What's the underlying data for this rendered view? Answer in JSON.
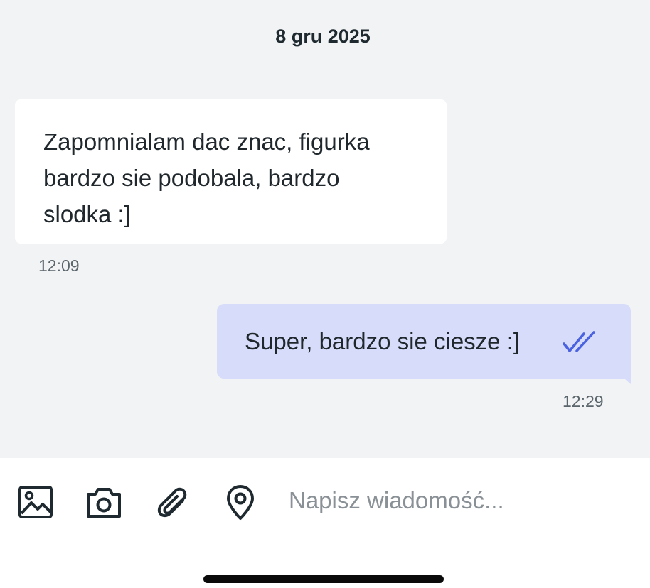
{
  "date_separator": "8 gru 2025",
  "messages": [
    {
      "direction": "incoming",
      "lines": [
        "Zapomnialam dac znac, figurka",
        "bardzo sie podobala, bardzo",
        "slodka :]"
      ],
      "time": "12:09"
    },
    {
      "direction": "outgoing",
      "text": "Super, bardzo sie ciesze :]",
      "time": "12:29",
      "status_icon": "double-check-icon"
    }
  ],
  "composer": {
    "placeholder": "Napisz wiadomość...",
    "icons": [
      "image-icon",
      "camera-icon",
      "paperclip-icon",
      "location-pin-icon"
    ]
  },
  "colors": {
    "background": "#f2f3f5",
    "incoming_bubble": "#ffffff",
    "outgoing_bubble": "#d6dcf9",
    "read_check": "#4a62e0",
    "icon": "#1f2a30"
  }
}
